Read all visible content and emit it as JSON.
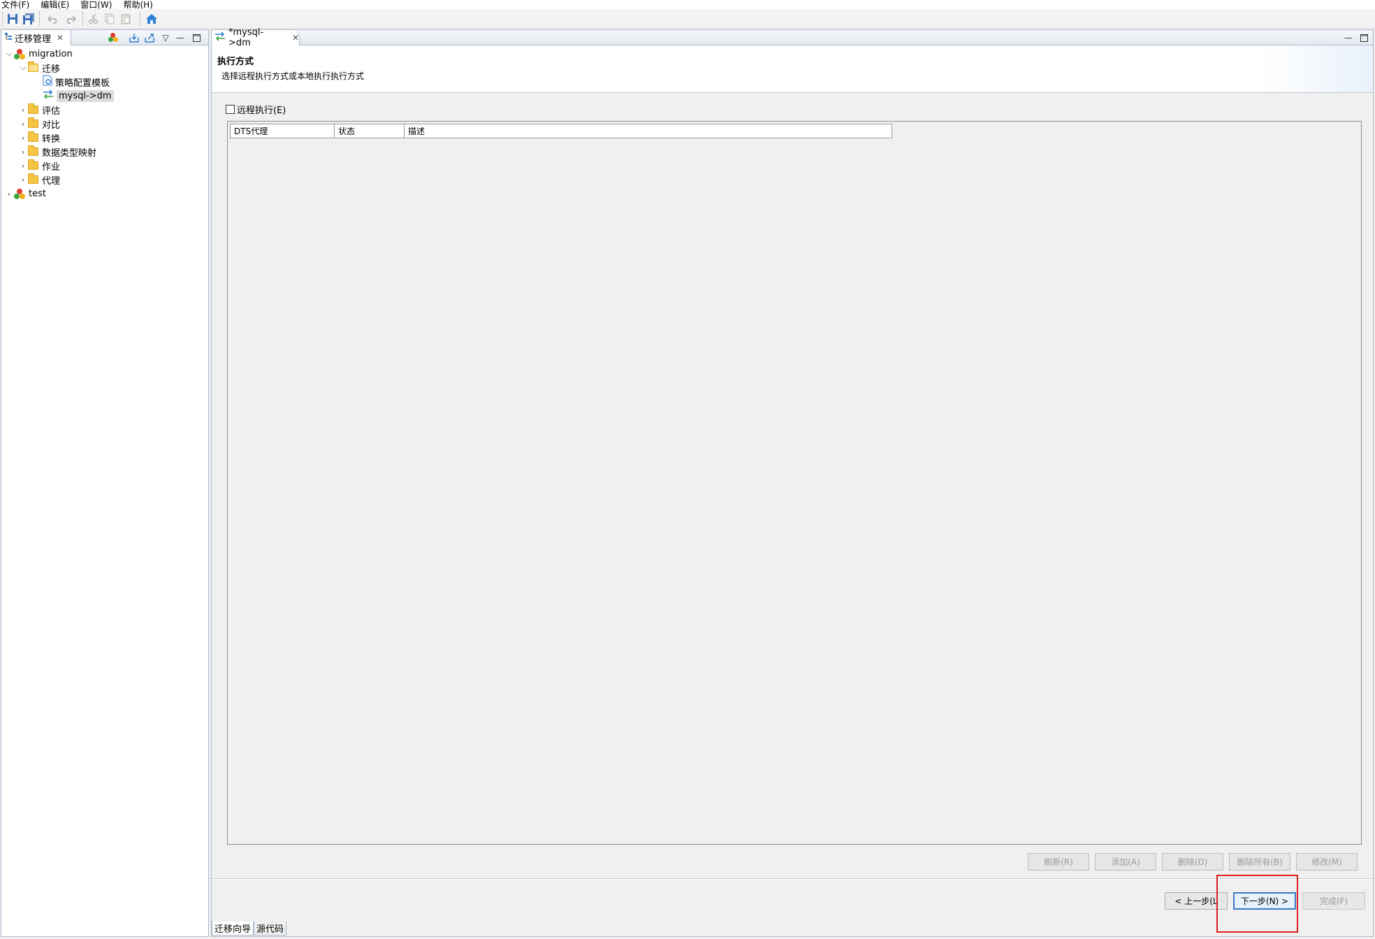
{
  "menu": [
    "文件(F)",
    "编辑(E)",
    "窗口(W)",
    "帮助(H)"
  ],
  "toolbar": {
    "icons": [
      "save-icon",
      "save-all-icon",
      "undo-icon",
      "redo-icon",
      "cut-icon",
      "copy-icon",
      "paste-icon",
      "home-icon"
    ]
  },
  "left_view": {
    "tab_label": "迁移管理",
    "tree": {
      "root1": "migration",
      "migrate_folder": "迁移",
      "strategy_template": "策略配置模板",
      "job_mysql_dm": "mysql->dm",
      "folders": [
        "评估",
        "对比",
        "转换",
        "数据类型映射",
        "作业",
        "代理"
      ],
      "root2": "test"
    }
  },
  "editor": {
    "tab_label": "*mysql->dm",
    "wizard_title": "执行方式",
    "wizard_desc": "选择远程执行方式或本地执行执行方式",
    "remote_checkbox_label": "远程执行(E)",
    "table_columns": [
      "DTS代理",
      "状态",
      "描述"
    ],
    "action_buttons": [
      "刷新(R)",
      "添加(A)",
      "删除(D)",
      "删除所有(B)",
      "修改(M)"
    ],
    "nav_buttons": {
      "back": "< 上一步(L",
      "next": "下一步(N) >",
      "finish": "完成(F)"
    },
    "bottom_tabs": [
      "迁移向导",
      "源代码"
    ]
  },
  "colors": {
    "highlight": "#e01e1e",
    "selection_border": "#3a76c8",
    "folder": "#f5c542",
    "view_border": "#a9b8cc"
  }
}
